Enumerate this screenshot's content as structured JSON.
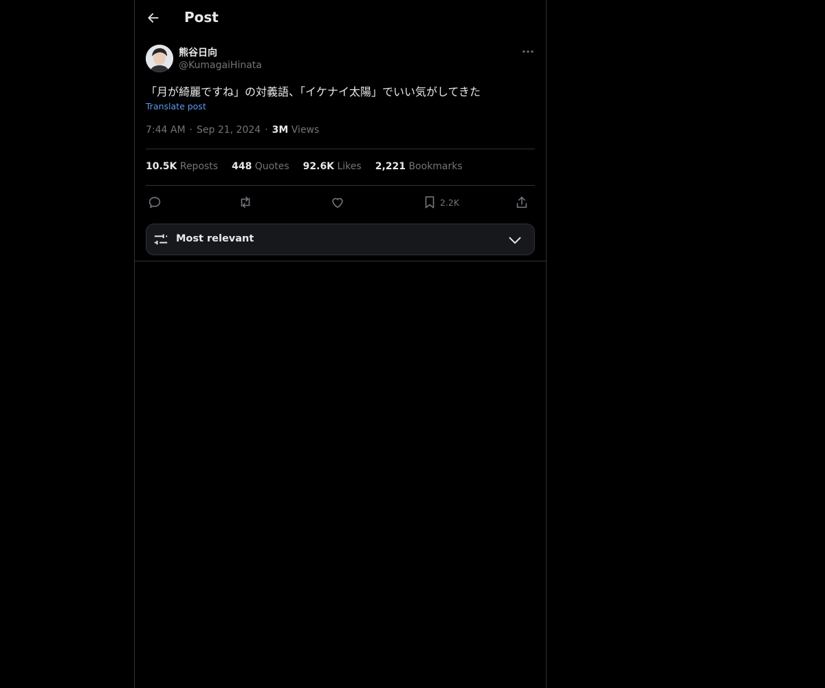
{
  "header": {
    "title": "Post",
    "back_icon": "arrow-left-icon"
  },
  "author": {
    "display_name": "熊谷日向",
    "handle": "@KumagaiHinata",
    "avatar": "avatar-photo"
  },
  "post": {
    "text": "「月が綺麗ですね」の対義語、「イケナイ太陽」でいい気がしてきた",
    "translate_label": "Translate post",
    "time": "7:44 AM",
    "date": "Sep 21, 2024",
    "views_count": "3M",
    "views_label": "Views"
  },
  "stats": [
    {
      "count": "10.5K",
      "label": "Reposts"
    },
    {
      "count": "448",
      "label": "Quotes"
    },
    {
      "count": "92.6K",
      "label": "Likes"
    },
    {
      "count": "2,221",
      "label": "Bookmarks"
    }
  ],
  "actions": {
    "reply_icon": "reply-icon",
    "repost_icon": "repost-icon",
    "like_icon": "heart-icon",
    "bookmark_icon": "bookmark-icon",
    "bookmark_count": "2.2K",
    "share_icon": "share-icon"
  },
  "sort": {
    "label": "Most relevant",
    "icon": "sliders-icon",
    "chevron": "chevron-down-icon"
  },
  "colors": {
    "background": "#000000",
    "text": "#e7e9ea",
    "muted": "#71767b",
    "link": "#5b9bf0",
    "border": "#2f3336"
  }
}
